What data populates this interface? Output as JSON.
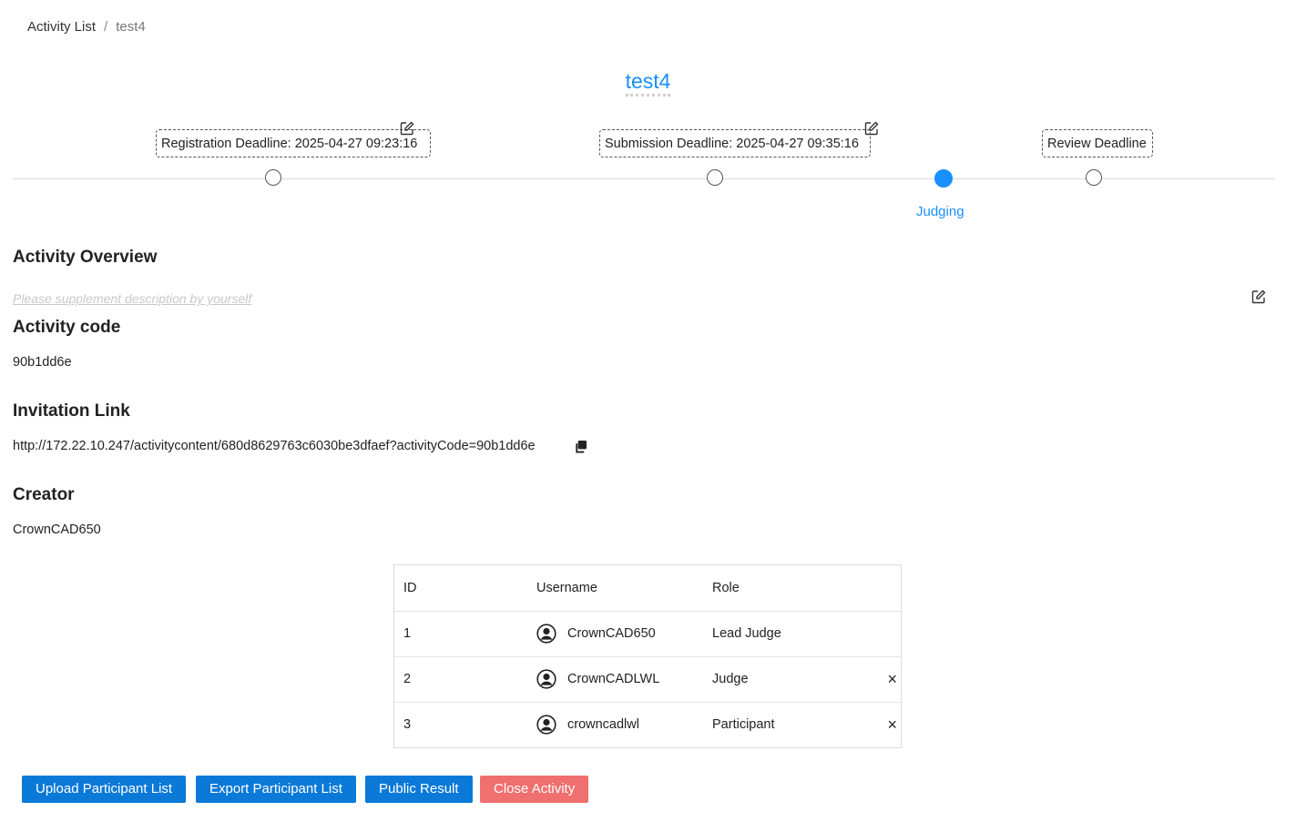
{
  "breadcrumb": {
    "parent": "Activity List",
    "separator": "/",
    "current": "test4"
  },
  "title": "test4",
  "timeline": {
    "registration_deadline": "Registration Deadline: 2025-04-27 09:23:16",
    "submission_deadline": "Submission Deadline: 2025-04-27 09:35:16",
    "review_deadline": "Review Deadline",
    "current_stage": "Judging"
  },
  "overview": {
    "heading": "Activity Overview",
    "description_placeholder": "Please supplement description by yourself"
  },
  "activity_code": {
    "heading": "Activity code",
    "value": "90b1dd6e"
  },
  "invitation": {
    "heading": "Invitation Link",
    "url": "http://172.22.10.247/activitycontent/680d8629763c6030be3dfaef?activityCode=90b1dd6e"
  },
  "creator": {
    "heading": "Creator",
    "value": "CrownCAD650"
  },
  "table": {
    "headers": {
      "id": "ID",
      "username": "Username",
      "role": "Role"
    },
    "rows": [
      {
        "id": "1",
        "username": "CrownCAD650",
        "role": "Lead Judge",
        "removable": false
      },
      {
        "id": "2",
        "username": "CrownCADLWL",
        "role": "Judge",
        "removable": true
      },
      {
        "id": "3",
        "username": "crowncadlwl",
        "role": "Participant",
        "removable": true
      }
    ],
    "remove_symbol": "×"
  },
  "buttons": {
    "upload": "Upload Participant List",
    "export": "Export Participant List",
    "public": "Public Result",
    "close": "Close Activity"
  },
  "colors": {
    "accent": "#1890ff",
    "primary_button": "#0a79d8",
    "danger_button": "#f06f6f"
  }
}
